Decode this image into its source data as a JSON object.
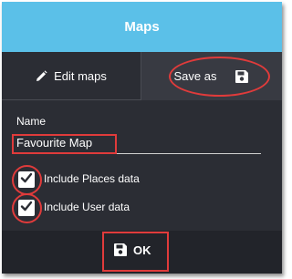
{
  "dialog": {
    "title": "Maps",
    "tabs": {
      "edit": {
        "label": "Edit maps",
        "icon": "pencil-icon"
      },
      "save": {
        "label": "Save as",
        "icon": "floppy-disk-icon"
      }
    },
    "form": {
      "name_label": "Name",
      "name_value": "Favourite Map",
      "checkboxes": [
        {
          "label": "Include Places data",
          "checked": true
        },
        {
          "label": "Include User data",
          "checked": true
        }
      ]
    },
    "footer": {
      "ok_label": "OK",
      "icon": "floppy-disk-icon"
    }
  },
  "colors": {
    "header": "#5bc0e8",
    "panel": "#2b2d34",
    "highlight": "#e03b3b"
  }
}
